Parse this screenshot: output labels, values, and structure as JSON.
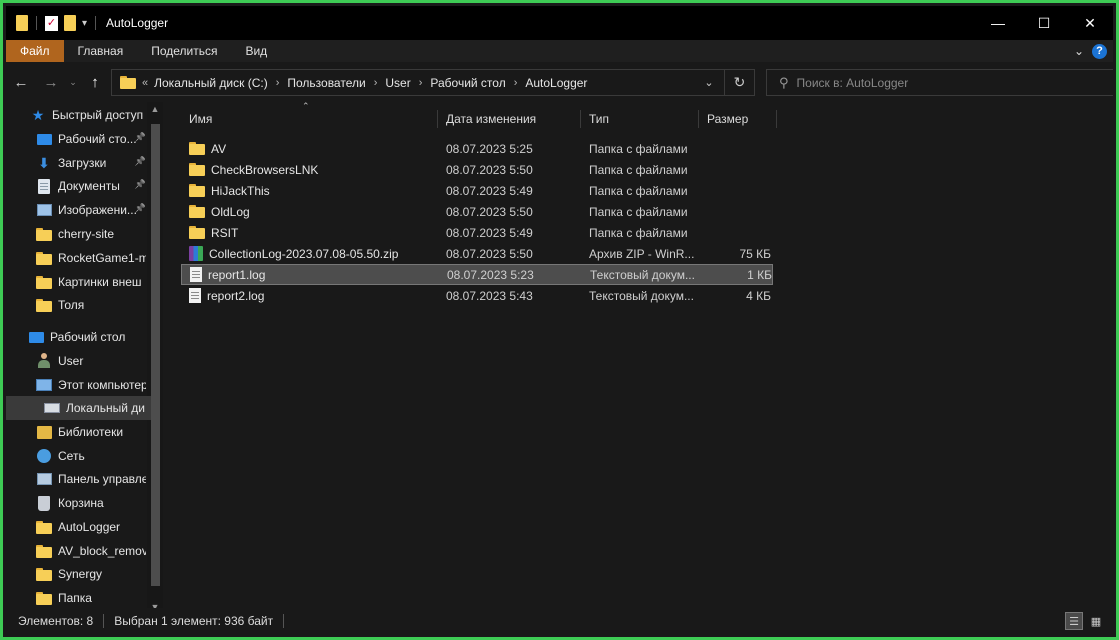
{
  "window": {
    "title": "AutoLogger"
  },
  "controls": {
    "minimize": "—",
    "maximize": "☐",
    "close": "✕"
  },
  "ribbon": {
    "tabs": [
      "Файл",
      "Главная",
      "Поделиться",
      "Вид"
    ],
    "help": "?"
  },
  "address": {
    "crumbs": [
      "Локальный диск (C:)",
      "Пользователи",
      "User",
      "Рабочий стол",
      "AutoLogger"
    ]
  },
  "search": {
    "placeholder": "Поиск в: AutoLogger"
  },
  "nav": {
    "items": [
      {
        "label": "Быстрый доступ",
        "icon": "star-icon",
        "pinned": false
      },
      {
        "label": "Рабочий сто...",
        "icon": "desktop-icon",
        "pinned": true
      },
      {
        "label": "Загрузки",
        "icon": "downloads-icon",
        "pinned": true
      },
      {
        "label": "Документы",
        "icon": "documents-icon",
        "pinned": true
      },
      {
        "label": "Изображени...",
        "icon": "pictures-icon",
        "pinned": true
      },
      {
        "label": "cherry-site",
        "icon": "folder-icon",
        "pinned": false
      },
      {
        "label": "RocketGame1-m",
        "icon": "folder-icon",
        "pinned": false
      },
      {
        "label": "Картинки внеш",
        "icon": "folder-icon",
        "pinned": false
      },
      {
        "label": "Толя",
        "icon": "folder-icon",
        "pinned": false
      },
      {
        "label": "Рабочий стол",
        "icon": "desktop-icon",
        "pinned": false
      },
      {
        "label": "User",
        "icon": "user-icon",
        "pinned": false
      },
      {
        "label": "Этот компьютер",
        "icon": "computer-icon",
        "pinned": false
      },
      {
        "label": "Локальный ди",
        "icon": "drive-icon",
        "pinned": false
      },
      {
        "label": "Библиотеки",
        "icon": "libraries-icon",
        "pinned": false
      },
      {
        "label": "Сеть",
        "icon": "network-icon",
        "pinned": false
      },
      {
        "label": "Панель управле",
        "icon": "control-panel-icon",
        "pinned": false
      },
      {
        "label": "Корзина",
        "icon": "recycle-bin-icon",
        "pinned": false
      },
      {
        "label": "AutoLogger",
        "icon": "folder-icon",
        "pinned": false
      },
      {
        "label": "AV_block_remov",
        "icon": "folder-icon",
        "pinned": false
      },
      {
        "label": "Synergy",
        "icon": "folder-icon",
        "pinned": false
      },
      {
        "label": "Папка",
        "icon": "folder-icon",
        "pinned": false
      }
    ]
  },
  "columns": {
    "name": "Имя",
    "date": "Дата изменения",
    "type": "Тип",
    "size": "Размер"
  },
  "files": [
    {
      "name": "AV",
      "date": "08.07.2023 5:25",
      "type": "Папка с файлами",
      "size": "",
      "icon": "folder-icon"
    },
    {
      "name": "CheckBrowsersLNK",
      "date": "08.07.2023 5:50",
      "type": "Папка с файлами",
      "size": "",
      "icon": "folder-icon"
    },
    {
      "name": "HiJackThis",
      "date": "08.07.2023 5:49",
      "type": "Папка с файлами",
      "size": "",
      "icon": "folder-icon"
    },
    {
      "name": "OldLog",
      "date": "08.07.2023 5:50",
      "type": "Папка с файлами",
      "size": "",
      "icon": "folder-icon"
    },
    {
      "name": "RSIT",
      "date": "08.07.2023 5:49",
      "type": "Папка с файлами",
      "size": "",
      "icon": "folder-icon"
    },
    {
      "name": "CollectionLog-2023.07.08-05.50.zip",
      "date": "08.07.2023 5:50",
      "type": "Архив ZIP - WinR...",
      "size": "75 КБ",
      "icon": "zip-icon"
    },
    {
      "name": "report1.log",
      "date": "08.07.2023 5:23",
      "type": "Текстовый докум...",
      "size": "1 КБ",
      "icon": "log-icon",
      "selected": true
    },
    {
      "name": "report2.log",
      "date": "08.07.2023 5:43",
      "type": "Текстовый докум...",
      "size": "4 КБ",
      "icon": "log-icon"
    }
  ],
  "status": {
    "count": "Элементов: 8",
    "selection": "Выбран 1 элемент: 936 байт"
  }
}
